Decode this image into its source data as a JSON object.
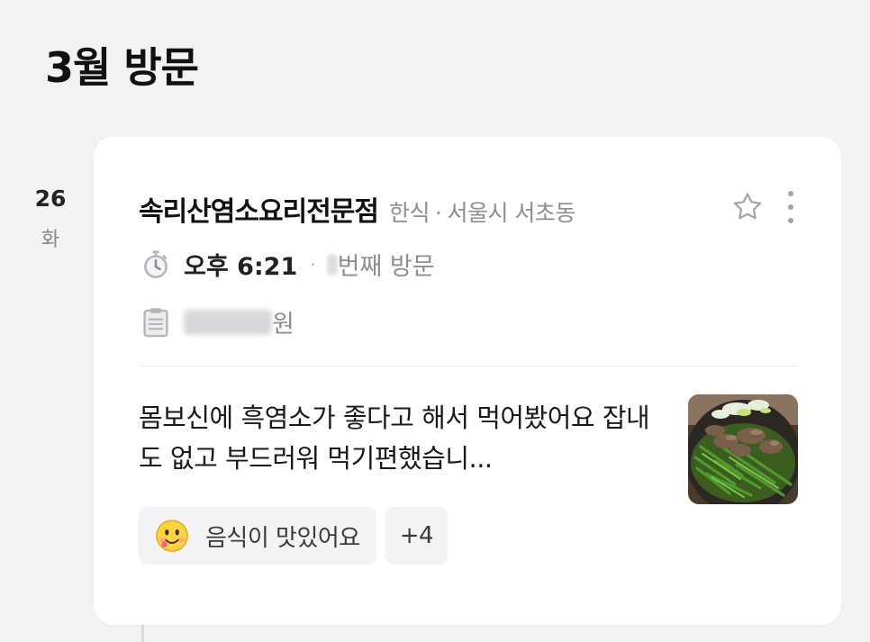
{
  "section": {
    "title": "3월 방문"
  },
  "entry": {
    "date": {
      "day": "26",
      "weekday": "화"
    },
    "place": {
      "name": "속리산염소요리전문점",
      "category": "한식",
      "separator": "·",
      "location": "서울시 서초동"
    },
    "visit": {
      "time": "오후 6:21",
      "separator": "·",
      "count_suffix": "번째 방문"
    },
    "price": {
      "unit": "원"
    },
    "review": {
      "text": "몸보신에 흑염소가 좋다고 해서 먹어봤어요 잡내도 없고 부드러워 먹기편했습니..."
    },
    "tags": {
      "primary": "음식이 맛있어요",
      "more": "+4"
    },
    "icons": {
      "favorite": "star-outline-icon",
      "more": "more-vertical-icon",
      "time": "stopwatch-icon",
      "price": "receipt-icon",
      "tag_emoji": "smiling-face-emoji"
    }
  },
  "colors": {
    "background": "#f2f2f4",
    "card": "#ffffff",
    "muted_text": "#8d8d92",
    "tag_background": "#f3f3f5"
  }
}
